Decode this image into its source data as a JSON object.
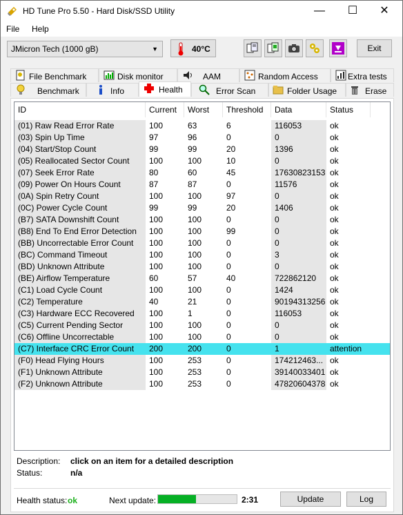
{
  "window": {
    "title": "HD Tune Pro 5.50 - Hard Disk/SSD Utility",
    "minimize": "—",
    "maximize": "☐",
    "close": "✕"
  },
  "menu": {
    "file": "File",
    "help": "Help"
  },
  "toolbar": {
    "drive": "JMicron Tech (1000 gB)",
    "temperature": "40°C",
    "exit_label": "Exit"
  },
  "tabs_top": [
    {
      "label": "File Benchmark",
      "icon": "file-benchmark-icon"
    },
    {
      "label": "Disk monitor",
      "icon": "disk-monitor-icon"
    },
    {
      "label": "AAM",
      "icon": "speaker-icon"
    },
    {
      "label": "Random Access",
      "icon": "random-access-icon"
    },
    {
      "label": "Extra tests",
      "icon": "extra-tests-icon"
    }
  ],
  "tabs_bottom": [
    {
      "label": "Benchmark",
      "icon": "benchmark-icon"
    },
    {
      "label": "Info",
      "icon": "info-icon"
    },
    {
      "label": "Health",
      "icon": "health-cross-icon"
    },
    {
      "label": "Error Scan",
      "icon": "error-scan-icon"
    },
    {
      "label": "Folder Usage",
      "icon": "folder-icon"
    },
    {
      "label": "Erase",
      "icon": "erase-bin-icon"
    }
  ],
  "table": {
    "columns": [
      "ID",
      "Current",
      "Worst",
      "Threshold",
      "Data",
      "Status"
    ],
    "rows": [
      [
        "(01) Raw Read Error Rate",
        "100",
        "63",
        "6",
        "116053",
        "ok"
      ],
      [
        "(03) Spin Up Time",
        "97",
        "96",
        "0",
        "0",
        "ok"
      ],
      [
        "(04) Start/Stop Count",
        "99",
        "99",
        "20",
        "1396",
        "ok"
      ],
      [
        "(05) Reallocated Sector Count",
        "100",
        "100",
        "10",
        "0",
        "ok"
      ],
      [
        "(07) Seek Error Rate",
        "80",
        "60",
        "45",
        "17630823153",
        "ok"
      ],
      [
        "(09) Power On Hours Count",
        "87",
        "87",
        "0",
        "11576",
        "ok"
      ],
      [
        "(0A) Spin Retry Count",
        "100",
        "100",
        "97",
        "0",
        "ok"
      ],
      [
        "(0C) Power Cycle Count",
        "99",
        "99",
        "20",
        "1406",
        "ok"
      ],
      [
        "(B7) SATA Downshift Count",
        "100",
        "100",
        "0",
        "0",
        "ok"
      ],
      [
        "(B8) End To End Error Detection",
        "100",
        "100",
        "99",
        "0",
        "ok"
      ],
      [
        "(BB) Uncorrectable Error Count",
        "100",
        "100",
        "0",
        "0",
        "ok"
      ],
      [
        "(BC) Command Timeout",
        "100",
        "100",
        "0",
        "3",
        "ok"
      ],
      [
        "(BD) Unknown Attribute",
        "100",
        "100",
        "0",
        "0",
        "ok"
      ],
      [
        "(BE) Airflow Temperature",
        "60",
        "57",
        "40",
        "722862120",
        "ok"
      ],
      [
        "(C1) Load Cycle Count",
        "100",
        "100",
        "0",
        "1424",
        "ok"
      ],
      [
        "(C2) Temperature",
        "40",
        "21",
        "0",
        "90194313256",
        "ok"
      ],
      [
        "(C3) Hardware ECC Recovered",
        "100",
        "1",
        "0",
        "116053",
        "ok"
      ],
      [
        "(C5) Current Pending Sector",
        "100",
        "100",
        "0",
        "0",
        "ok"
      ],
      [
        "(C6) Offline Uncorrectable",
        "100",
        "100",
        "0",
        "0",
        "ok"
      ],
      [
        "(C7) Interface CRC Error Count",
        "200",
        "200",
        "0",
        "1",
        "attention"
      ],
      [
        "(F0) Head Flying Hours",
        "100",
        "253",
        "0",
        "174212463...",
        "ok"
      ],
      [
        "(F1) Unknown Attribute",
        "100",
        "253",
        "0",
        "39140033401",
        "ok"
      ],
      [
        "(F2) Unknown Attribute",
        "100",
        "253",
        "0",
        "47820604378",
        "ok"
      ]
    ],
    "selected_row": 19
  },
  "description": {
    "desc_label": "Description:",
    "desc_value": "click on an item for a detailed description",
    "status_label": "Status:",
    "status_value": "n/a"
  },
  "footer": {
    "health_label": "Health status:",
    "health_value": "ok",
    "next_update_label": "Next update:",
    "progress": 0.48,
    "time": "2:31",
    "update_label": "Update",
    "log_label": "Log"
  },
  "colors": {
    "selected_row": "#45e2ee",
    "progress": "#06b025",
    "health_ok": "#1aaf1a"
  }
}
